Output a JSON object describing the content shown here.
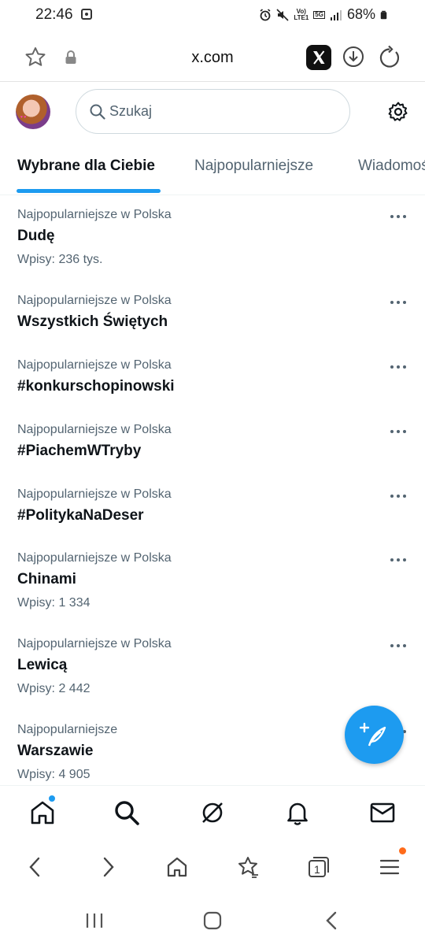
{
  "status_bar": {
    "time": "22:46",
    "network_vo": "Vo)",
    "network_lte": "LTE1",
    "network_5g": "5G",
    "battery": "68%"
  },
  "browser": {
    "url": "x.com"
  },
  "header": {
    "search_placeholder": "Szukaj"
  },
  "tabs": [
    {
      "label": "Wybrane dla Ciebie",
      "active": true
    },
    {
      "label": "Najpopularniejsze",
      "active": false
    },
    {
      "label": "Wiadomości",
      "active": false
    }
  ],
  "trends": [
    {
      "context": "Najpopularniejsze w Polska",
      "name": "Dudę",
      "count": "Wpisy: 236 tys."
    },
    {
      "context": "Najpopularniejsze w Polska",
      "name": "Wszystkich Świętych",
      "count": ""
    },
    {
      "context": "Najpopularniejsze w Polska",
      "name": "#konkurschopinowski",
      "count": ""
    },
    {
      "context": "Najpopularniejsze w Polska",
      "name": "#PiachemWTryby",
      "count": ""
    },
    {
      "context": "Najpopularniejsze w Polska",
      "name": "#PolitykaNaDeser",
      "count": ""
    },
    {
      "context": "Najpopularniejsze w Polska",
      "name": "Chinami",
      "count": "Wpisy: 1 334"
    },
    {
      "context": "Najpopularniejsze w Polska",
      "name": "Lewicą",
      "count": "Wpisy: 2 442"
    },
    {
      "context": "Najpopularniejsze",
      "name": "Warszawie",
      "count": "Wpisy: 4 905"
    }
  ],
  "browser_toolbar": {
    "tab_count": "1"
  },
  "colors": {
    "accent": "#1d9bf0",
    "text_primary": "#0f1419",
    "text_secondary": "#536471",
    "menu_badge": "#ff6b1a"
  }
}
